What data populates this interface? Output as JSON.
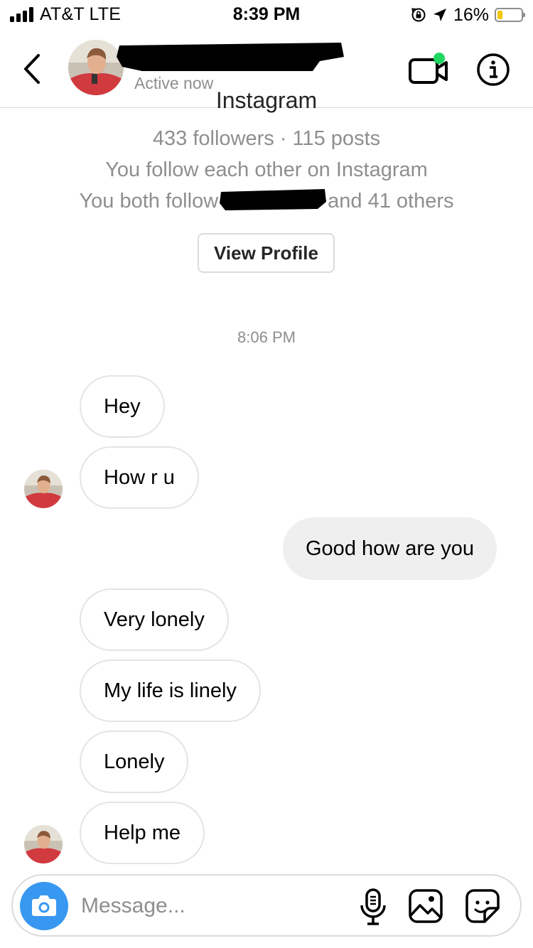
{
  "status_bar": {
    "carrier": "AT&T  LTE",
    "time": "8:39 PM",
    "battery_percent": "16%",
    "battery_level": 0.16,
    "icons": [
      "signal-bars-icon",
      "orientation-lock-icon",
      "location-arrow-icon",
      "battery-icon"
    ]
  },
  "header": {
    "status": "Active now",
    "icons": [
      "back-chevron-icon",
      "video-call-icon",
      "info-icon"
    ],
    "active_dot_color": "#1ed760"
  },
  "profile": {
    "clipped_line": "Instagram",
    "stats": "433 followers · 115 posts",
    "mutual_follow": "You follow each other on Instagram",
    "both_follow_prefix": "You both follow",
    "both_follow_suffix": "and 41 others",
    "view_profile_label": "View Profile"
  },
  "timestamp": "8:06 PM",
  "messages": [
    {
      "from": "them",
      "text": "Hey"
    },
    {
      "from": "them",
      "text": "How r u"
    },
    {
      "from": "me",
      "text": "Good how are you"
    },
    {
      "from": "them",
      "text": "Very lonely"
    },
    {
      "from": "them",
      "text": "My life is linely"
    },
    {
      "from": "them",
      "text": "Lonely"
    },
    {
      "from": "them",
      "text": "Help me"
    }
  ],
  "composer": {
    "placeholder": "Message...",
    "icons": [
      "camera-icon",
      "microphone-icon",
      "gallery-icon",
      "sticker-icon"
    ],
    "camera_color": "#3897f0"
  }
}
